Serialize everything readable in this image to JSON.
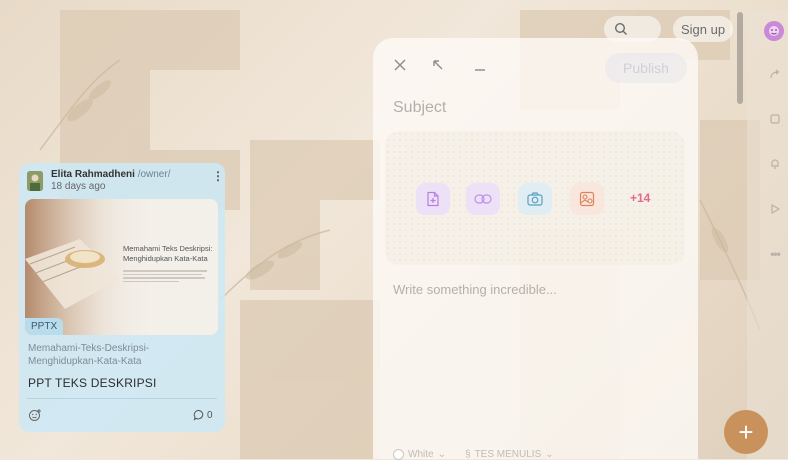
{
  "topbar": {
    "signup_label": "Sign up",
    "search_icon": "search-icon"
  },
  "rail": {
    "icons": [
      "avatar-icon",
      "share-icon",
      "copy-icon",
      "bell-icon",
      "play-icon",
      "more-icon"
    ],
    "more_label": "•••"
  },
  "card": {
    "author": "Elita Rahmadheni",
    "role": "/owner/",
    "time": "18 days ago",
    "thumb_title": "Memahami Teks Deskripsi: Menghidupkan Kata-Kata",
    "badge": "PPTX",
    "filename": "Memahami-Teks-Deskripsi-Menghidupkan-Kata-Kata",
    "title": "PPT TEKS DESKRIPSI",
    "comment_count": "0",
    "menu_glyph": "⋮"
  },
  "composer": {
    "publish_label": "Publish",
    "subject_placeholder": "Subject",
    "body_placeholder": "Write something incredible...",
    "more_attachments": "+14",
    "color_option": "White",
    "category_option": "TES MENULIS"
  },
  "fab_label": "+",
  "colors": {
    "accent": "#c9915c",
    "card_bg": "#cee8f4",
    "pink": "#e36a8c",
    "purple": "#b67fe0"
  }
}
